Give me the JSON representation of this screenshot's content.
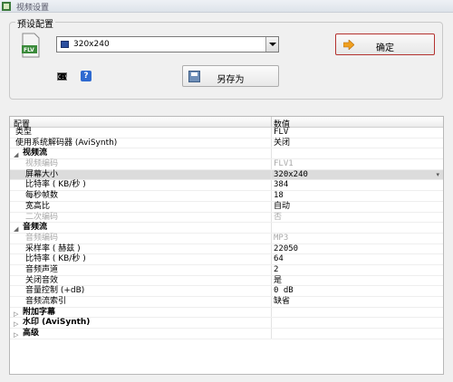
{
  "window": {
    "title": "视频设置"
  },
  "preset": {
    "legend": "预设配置",
    "format_icon_text": "FLV",
    "combo_value": "320x240",
    "ok_label": "确定",
    "cmd_icon_text": "C:\\",
    "help_icon_text": "?",
    "saveas_label": "另存为"
  },
  "grid": {
    "columns": [
      "配置",
      "数值"
    ],
    "rows": [
      {
        "name": "类型",
        "value": "FLV",
        "kind": "normal"
      },
      {
        "name": "使用系统解码器 (AviSynth)",
        "value": "关闭",
        "kind": "normal"
      },
      {
        "name": "视频流",
        "value": "",
        "kind": "category",
        "expanded": true
      },
      {
        "name": "视频编码",
        "value": "FLV1",
        "kind": "disabled"
      },
      {
        "name": "屏幕大小",
        "value": "320x240",
        "kind": "selected",
        "has_dropdown": true
      },
      {
        "name": "比特率 ( KB/秒 )",
        "value": "384",
        "kind": "child"
      },
      {
        "name": "每秒帧数",
        "value": "18",
        "kind": "child"
      },
      {
        "name": "宽高比",
        "value": "自动",
        "kind": "child"
      },
      {
        "name": "二次编码",
        "value": "否",
        "kind": "disabled"
      },
      {
        "name": "音频流",
        "value": "",
        "kind": "category",
        "expanded": true
      },
      {
        "name": "音频编码",
        "value": "MP3",
        "kind": "disabled"
      },
      {
        "name": "采样率 ( 赫兹 )",
        "value": "22050",
        "kind": "child"
      },
      {
        "name": "比特率 ( KB/秒 )",
        "value": "64",
        "kind": "child"
      },
      {
        "name": "音频声道",
        "value": "2",
        "kind": "child"
      },
      {
        "name": "关闭音效",
        "value": "是",
        "kind": "child"
      },
      {
        "name": "音量控制 (+dB)",
        "value": "0 dB",
        "kind": "child"
      },
      {
        "name": "音频流索引",
        "value": "缺省",
        "kind": "child"
      },
      {
        "name": "附加字幕",
        "value": "",
        "kind": "category",
        "expanded": false
      },
      {
        "name": "水印 (AviSynth)",
        "value": "",
        "kind": "category",
        "expanded": false
      },
      {
        "name": "高级",
        "value": "",
        "kind": "category",
        "expanded": false
      }
    ]
  },
  "colors": {
    "ok_border": "#b4322f",
    "selected_row": "#dcdcdc",
    "disabled_text": "#a9a9a9"
  }
}
